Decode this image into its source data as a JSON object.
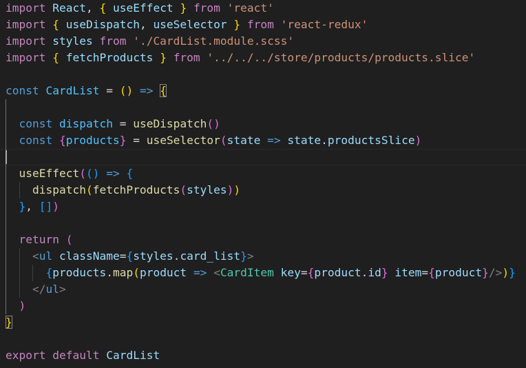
{
  "editor": {
    "language": "javascript-react",
    "cursor_line": 9,
    "lines": [
      {
        "tokens": [
          {
            "t": "import",
            "c": "kw"
          },
          {
            "t": " "
          },
          {
            "t": "React",
            "c": "vr"
          },
          {
            "t": ", "
          },
          {
            "t": "{",
            "c": "b1"
          },
          {
            "t": " "
          },
          {
            "t": "useEffect",
            "c": "vr"
          },
          {
            "t": " "
          },
          {
            "t": "}",
            "c": "b1"
          },
          {
            "t": " "
          },
          {
            "t": "from",
            "c": "kw"
          },
          {
            "t": " "
          },
          {
            "t": "'react'",
            "c": "st"
          }
        ]
      },
      {
        "tokens": [
          {
            "t": "import",
            "c": "kw"
          },
          {
            "t": " "
          },
          {
            "t": "{",
            "c": "b1"
          },
          {
            "t": " "
          },
          {
            "t": "useDispatch",
            "c": "vr"
          },
          {
            "t": ", "
          },
          {
            "t": "useSelector",
            "c": "vr"
          },
          {
            "t": " "
          },
          {
            "t": "}",
            "c": "b1"
          },
          {
            "t": " "
          },
          {
            "t": "from",
            "c": "kw"
          },
          {
            "t": " "
          },
          {
            "t": "'react-redux'",
            "c": "st"
          }
        ]
      },
      {
        "tokens": [
          {
            "t": "import",
            "c": "kw"
          },
          {
            "t": " "
          },
          {
            "t": "styles",
            "c": "vr"
          },
          {
            "t": " "
          },
          {
            "t": "from",
            "c": "kw"
          },
          {
            "t": " "
          },
          {
            "t": "'./CardList.module.scss'",
            "c": "st"
          }
        ]
      },
      {
        "tokens": [
          {
            "t": "import",
            "c": "kw"
          },
          {
            "t": " "
          },
          {
            "t": "{",
            "c": "b1"
          },
          {
            "t": " "
          },
          {
            "t": "fetchProducts",
            "c": "vr"
          },
          {
            "t": " "
          },
          {
            "t": "}",
            "c": "b1"
          },
          {
            "t": " "
          },
          {
            "t": "from",
            "c": "kw"
          },
          {
            "t": " "
          },
          {
            "t": "'../../../store/products/products.slice'",
            "c": "st"
          }
        ]
      },
      {
        "tokens": []
      },
      {
        "tokens": [
          {
            "t": "const",
            "c": "sk"
          },
          {
            "t": " "
          },
          {
            "t": "CardList",
            "c": "cn"
          },
          {
            "t": " = "
          },
          {
            "t": "(",
            "c": "b1"
          },
          {
            "t": ")",
            "c": "b1"
          },
          {
            "t": " "
          },
          {
            "t": "=>",
            "c": "sk"
          },
          {
            "t": " "
          },
          {
            "t": "{",
            "c": "b1",
            "h": true
          }
        ]
      },
      {
        "tokens": []
      },
      {
        "tokens": [
          {
            "t": "  "
          },
          {
            "t": "const",
            "c": "sk"
          },
          {
            "t": " "
          },
          {
            "t": "dispatch",
            "c": "cn"
          },
          {
            "t": " = "
          },
          {
            "t": "useDispatch",
            "c": "fn"
          },
          {
            "t": "(",
            "c": "b2"
          },
          {
            "t": ")",
            "c": "b2"
          }
        ]
      },
      {
        "tokens": [
          {
            "t": "  "
          },
          {
            "t": "const",
            "c": "sk"
          },
          {
            "t": " "
          },
          {
            "t": "{",
            "c": "b2"
          },
          {
            "t": "products",
            "c": "cn"
          },
          {
            "t": "}",
            "c": "b2"
          },
          {
            "t": " = "
          },
          {
            "t": "useSelector",
            "c": "fn"
          },
          {
            "t": "(",
            "c": "b2"
          },
          {
            "t": "state",
            "c": "vr"
          },
          {
            "t": " "
          },
          {
            "t": "=>",
            "c": "sk"
          },
          {
            "t": " "
          },
          {
            "t": "state",
            "c": "vr"
          },
          {
            "t": "."
          },
          {
            "t": "productsSlice",
            "c": "vr"
          },
          {
            "t": ")",
            "c": "b2"
          }
        ]
      },
      {
        "tokens": []
      },
      {
        "tokens": [
          {
            "t": "  "
          },
          {
            "t": "useEffect",
            "c": "fn"
          },
          {
            "t": "(",
            "c": "b2"
          },
          {
            "t": "(",
            "c": "b3"
          },
          {
            "t": ")",
            "c": "b3"
          },
          {
            "t": " "
          },
          {
            "t": "=>",
            "c": "sk"
          },
          {
            "t": " "
          },
          {
            "t": "{",
            "c": "b3"
          }
        ]
      },
      {
        "tokens": [
          {
            "t": "    "
          },
          {
            "t": "dispatch",
            "c": "fn"
          },
          {
            "t": "(",
            "c": "b1"
          },
          {
            "t": "fetchProducts",
            "c": "fn"
          },
          {
            "t": "(",
            "c": "b2"
          },
          {
            "t": "styles",
            "c": "vr"
          },
          {
            "t": ")",
            "c": "b2"
          },
          {
            "t": ")",
            "c": "b1"
          }
        ]
      },
      {
        "tokens": [
          {
            "t": "  "
          },
          {
            "t": "}",
            "c": "b3"
          },
          {
            "t": ", "
          },
          {
            "t": "[",
            "c": "b3"
          },
          {
            "t": "]",
            "c": "b3"
          },
          {
            "t": ")",
            "c": "b2"
          }
        ]
      },
      {
        "tokens": []
      },
      {
        "tokens": [
          {
            "t": "  "
          },
          {
            "t": "return",
            "c": "kw"
          },
          {
            "t": " "
          },
          {
            "t": "(",
            "c": "b2"
          }
        ]
      },
      {
        "tokens": [
          {
            "t": "    "
          },
          {
            "t": "<",
            "c": "ag"
          },
          {
            "t": "ul",
            "c": "tg"
          },
          {
            "t": " "
          },
          {
            "t": "className",
            "c": "at"
          },
          {
            "t": "="
          },
          {
            "t": "{",
            "c": "b3"
          },
          {
            "t": "styles",
            "c": "vr"
          },
          {
            "t": "."
          },
          {
            "t": "card_list",
            "c": "vr"
          },
          {
            "t": "}",
            "c": "b3"
          },
          {
            "t": ">",
            "c": "ag"
          }
        ]
      },
      {
        "tokens": [
          {
            "t": "      "
          },
          {
            "t": "{",
            "c": "b3"
          },
          {
            "t": "products",
            "c": "vr"
          },
          {
            "t": "."
          },
          {
            "t": "map",
            "c": "fn"
          },
          {
            "t": "(",
            "c": "b1"
          },
          {
            "t": "product",
            "c": "vr"
          },
          {
            "t": " "
          },
          {
            "t": "=>",
            "c": "sk"
          },
          {
            "t": " "
          },
          {
            "t": "<",
            "c": "ag"
          },
          {
            "t": "CardItem",
            "c": "cm"
          },
          {
            "t": " "
          },
          {
            "t": "key",
            "c": "at"
          },
          {
            "t": "="
          },
          {
            "t": "{",
            "c": "b2"
          },
          {
            "t": "product",
            "c": "vr"
          },
          {
            "t": "."
          },
          {
            "t": "id",
            "c": "vr"
          },
          {
            "t": "}",
            "c": "b2"
          },
          {
            "t": " "
          },
          {
            "t": "item",
            "c": "at"
          },
          {
            "t": "="
          },
          {
            "t": "{",
            "c": "b2"
          },
          {
            "t": "product",
            "c": "vr"
          },
          {
            "t": "}",
            "c": "b2"
          },
          {
            "t": "/>",
            "c": "ag"
          },
          {
            "t": ")",
            "c": "b1"
          },
          {
            "t": "}",
            "c": "b3"
          }
        ]
      },
      {
        "tokens": [
          {
            "t": "    "
          },
          {
            "t": "</",
            "c": "ag"
          },
          {
            "t": "ul",
            "c": "tg"
          },
          {
            "t": ">",
            "c": "ag"
          }
        ]
      },
      {
        "tokens": [
          {
            "t": "  "
          },
          {
            "t": ")",
            "c": "b2"
          }
        ]
      },
      {
        "tokens": [
          {
            "t": "}",
            "c": "b1",
            "h": true
          }
        ]
      },
      {
        "tokens": []
      },
      {
        "tokens": [
          {
            "t": "export",
            "c": "kw"
          },
          {
            "t": " "
          },
          {
            "t": "default",
            "c": "kw"
          },
          {
            "t": " "
          },
          {
            "t": "CardList",
            "c": "vr"
          }
        ]
      }
    ]
  }
}
